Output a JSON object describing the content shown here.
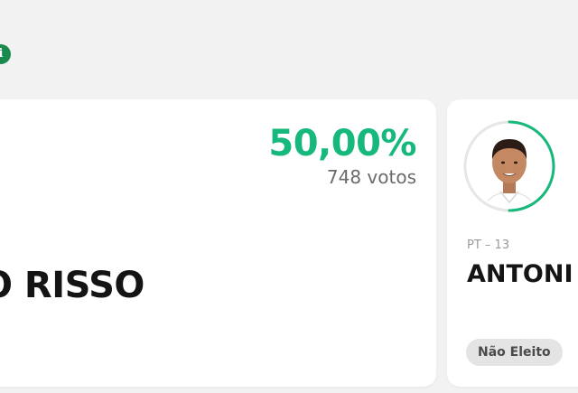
{
  "header": {
    "info_icon": "info-icon",
    "info_icon_glyph": "i",
    "accent_color": "#1a8a4e"
  },
  "cards": [
    {
      "percentage": "50,00%",
      "votes": "748 votos",
      "name": "O RISSO",
      "percentage_color": "#17b87b"
    },
    {
      "party": "PT – 13",
      "name": "ANTONI",
      "status": "Não Eleito",
      "avatar_icon": "candidate-photo",
      "ring_color": "#17b87b",
      "ring_progress": 0.5
    }
  ]
}
